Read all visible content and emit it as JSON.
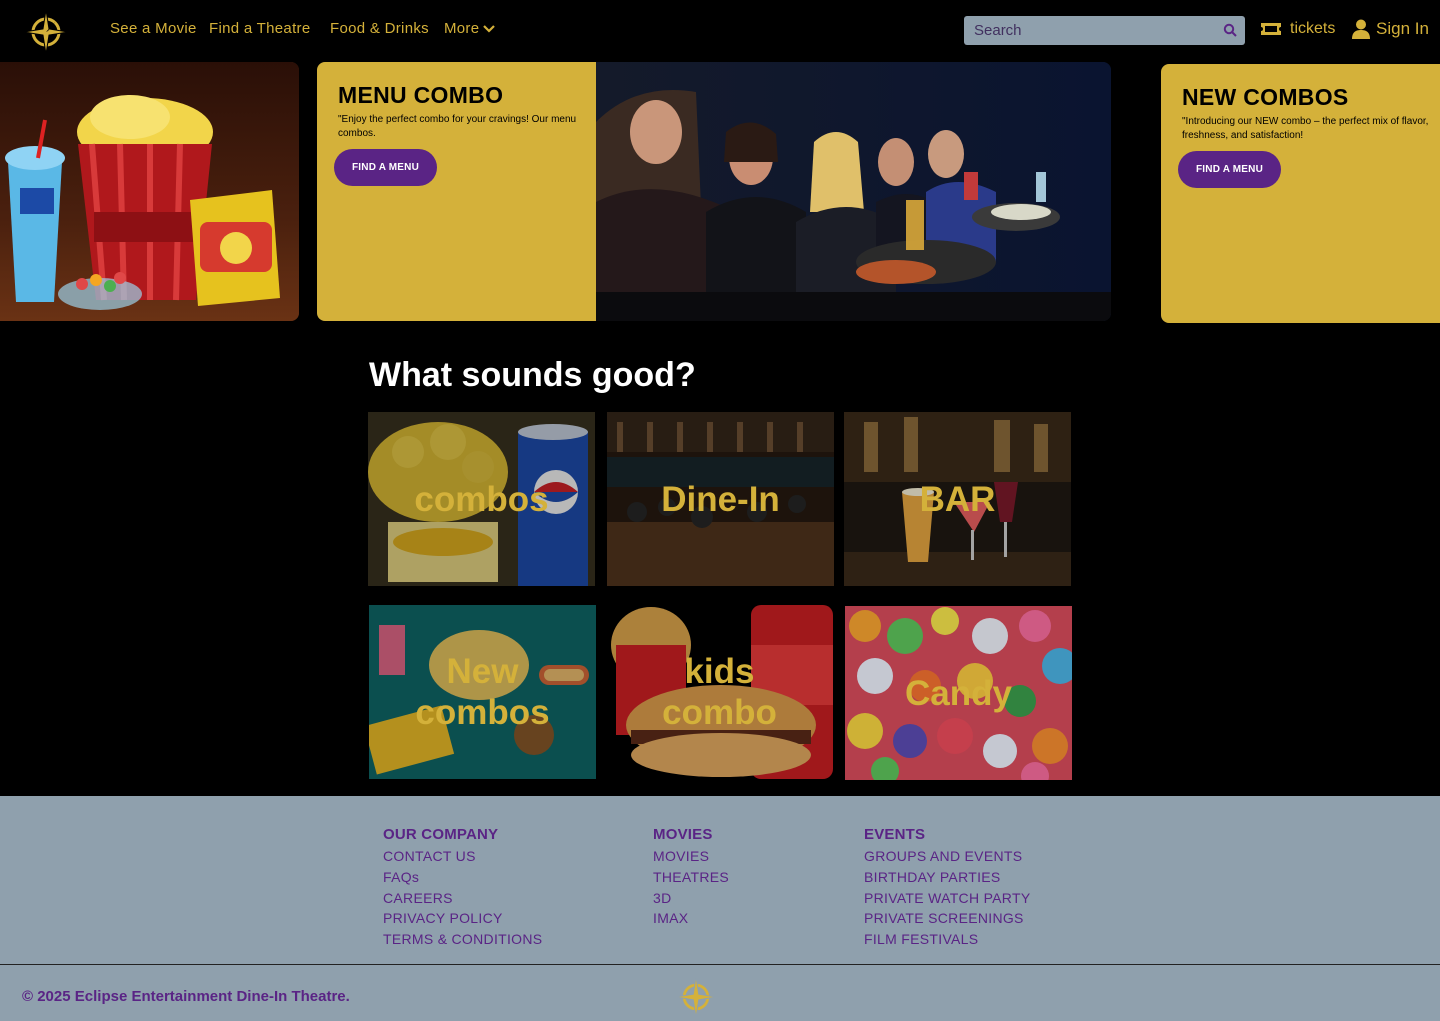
{
  "nav": {
    "links": [
      {
        "label": "See a Movie"
      },
      {
        "label": "Find a Theatre"
      },
      {
        "label": "Food & Drinks"
      },
      {
        "label": "More"
      }
    ],
    "search_placeholder": "Search",
    "tickets_label": "tickets",
    "signin_label": "Sign In",
    "icons": [
      "compass-star-logo",
      "chevron-down-icon",
      "search-icon",
      "ticket-icon",
      "user-icon"
    ]
  },
  "hero": {
    "left_image": "popcorn-icee-candy-photo",
    "card1": {
      "title": "MENU COMBO",
      "text": "\"Enjoy the perfect combo for your cravings! Our menu combos.",
      "button": "FIND A MENU"
    },
    "photo": "audience-dining-in-theatre-photo",
    "card2": {
      "title": "NEW COMBOS",
      "text": "\"Introducing our NEW combo – the perfect mix of flavor, freshness, and satisfaction!",
      "button": "FIND A MENU"
    }
  },
  "section": {
    "title": "What sounds good?",
    "tiles": [
      {
        "label": "combos"
      },
      {
        "label": "Dine-In"
      },
      {
        "label": "BAR"
      },
      {
        "label": "New combos"
      },
      {
        "label": "kids combo"
      },
      {
        "label": "Candy"
      }
    ]
  },
  "footer": {
    "columns": [
      {
        "heading": "OUR COMPANY",
        "links": [
          "CONTACT US",
          "FAQs",
          "CAREERS",
          "PRIVACY POLICY",
          "TERMS & CONDITIONS"
        ]
      },
      {
        "heading": "MOVIES",
        "links": [
          "MOVIES",
          "THEATRES",
          "3D",
          "IMAX"
        ]
      },
      {
        "heading": "EVENTS",
        "links": [
          "GROUPS AND EVENTS",
          "BIRTHDAY PARTIES",
          "PRIVATE WATCH PARTY",
          "PRIVATE SCREENINGS",
          "FILM FESTIVALS"
        ]
      }
    ],
    "copyright": "© 2025 Eclipse Entertainment Dine-In Theatre."
  },
  "colors": {
    "accent_gold": "#d4b13a",
    "button_purple": "#5a2485",
    "footer_bg": "#8fa0ad",
    "page_bg": "#000000"
  }
}
